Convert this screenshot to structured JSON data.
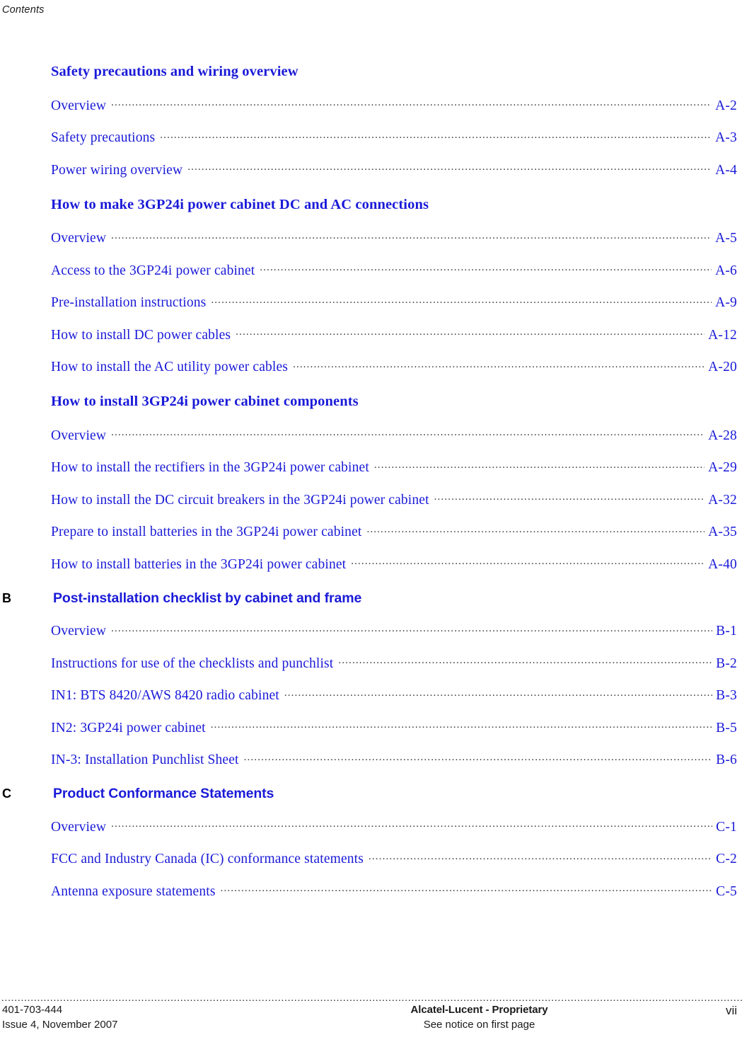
{
  "header": {
    "running_title": "Contents"
  },
  "colors": {
    "link_blue": "#1a1ad8",
    "text_black": "#000000",
    "leader_gray": "#3a3a3a"
  },
  "toc": {
    "blocks": [
      {
        "kind": "section",
        "title": "Safety precautions and wiring overview",
        "entries": [
          {
            "label": "Overview",
            "page": "A-2"
          },
          {
            "label": "Safety precautions",
            "page": "A-3"
          },
          {
            "label": "Power wiring overview",
            "page": "A-4"
          }
        ]
      },
      {
        "kind": "section",
        "title": "How to make 3GP24i power cabinet DC and AC connections",
        "entries": [
          {
            "label": "Overview",
            "page": "A-5"
          },
          {
            "label": "Access to the 3GP24i power cabinet",
            "page": "A-6"
          },
          {
            "label": "Pre-installation instructions",
            "page": "A-9"
          },
          {
            "label": "How to install DC power cables",
            "page": "A-12"
          },
          {
            "label": "How to install the AC utility power cables",
            "page": "A-20"
          }
        ]
      },
      {
        "kind": "section",
        "title": "How to install 3GP24i power cabinet components",
        "entries": [
          {
            "label": "Overview",
            "page": "A-28"
          },
          {
            "label": "How to install the rectifiers in the 3GP24i power cabinet",
            "page": "A-29"
          },
          {
            "label": "How to install the DC circuit breakers in the 3GP24i power cabinet",
            "page": "A-32"
          },
          {
            "label": "Prepare to install batteries in the 3GP24i power cabinet",
            "page": "A-35"
          },
          {
            "label": "How to install batteries in the 3GP24i power cabinet",
            "page": "A-40"
          }
        ]
      },
      {
        "kind": "appendix",
        "letter": "B",
        "title": "Post-installation checklist by cabinet and frame",
        "entries": [
          {
            "label": "Overview",
            "page": "B-1"
          },
          {
            "label": "Instructions for use of the checklists and punchlist",
            "page": "B-2"
          },
          {
            "label": "IN1: BTS 8420/AWS 8420 radio cabinet",
            "page": "B-3"
          },
          {
            "label": "IN2: 3GP24i power cabinet",
            "page": "B-5"
          },
          {
            "label": "IN-3: Installation Punchlist Sheet",
            "page": "B-6"
          }
        ]
      },
      {
        "kind": "appendix",
        "letter": "C",
        "title": "Product Conformance Statements",
        "entries": [
          {
            "label": "Overview",
            "page": "C-1"
          },
          {
            "label": "FCC and Industry Canada (IC) conformance statements",
            "page": "C-2"
          },
          {
            "label": "Antenna exposure statements",
            "page": "C-5"
          }
        ]
      }
    ]
  },
  "footer": {
    "document_number": "401-703-444",
    "issue_line": "Issue 4, November 2007",
    "proprietary_line": "Alcatel-Lucent - Proprietary",
    "notice_line": "See notice on first page",
    "page_number": "vii",
    "rule_dots": "......................................................................................................................................................................................................................................................................................................................................................................................................................................................................"
  }
}
